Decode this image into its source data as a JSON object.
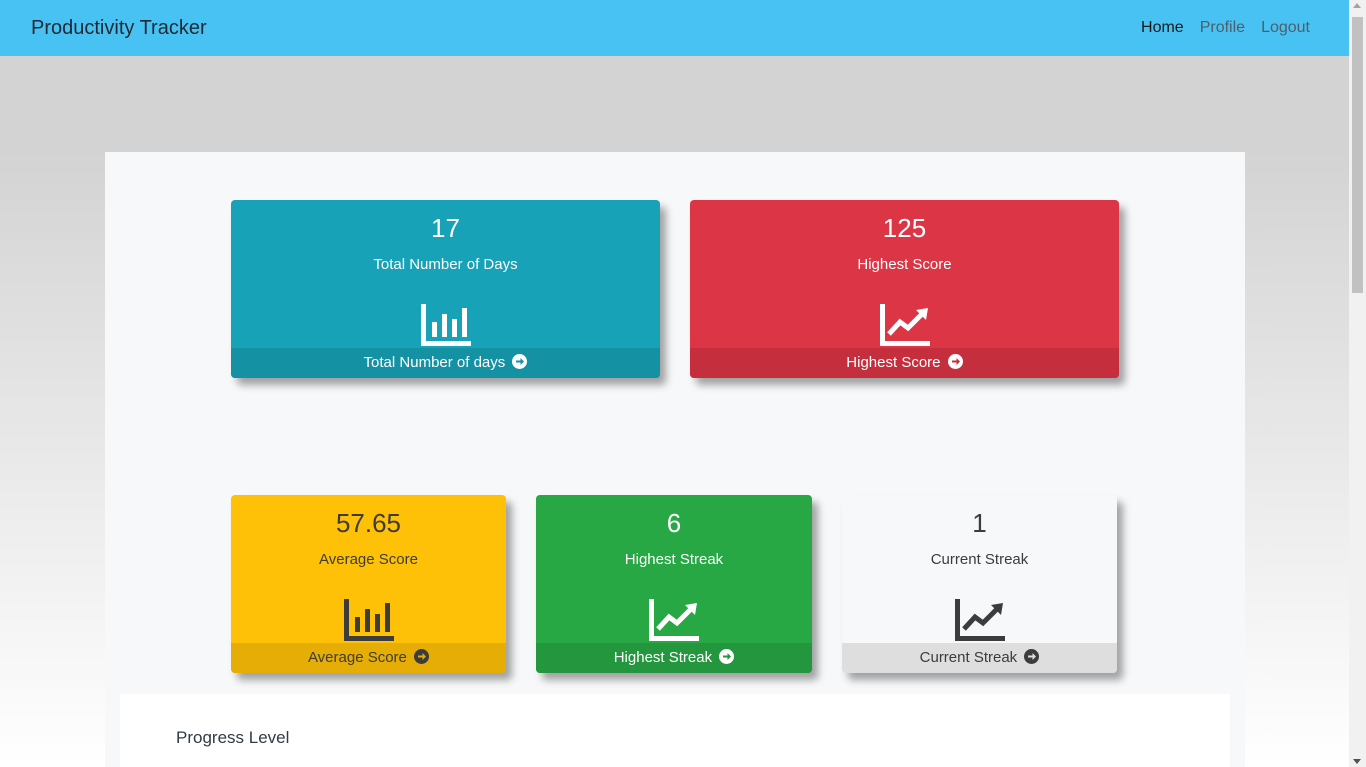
{
  "app": {
    "title": "Productivity Tracker"
  },
  "nav": {
    "items": [
      {
        "label": "Home",
        "active": true
      },
      {
        "label": "Profile",
        "active": false
      },
      {
        "label": "Logout",
        "active": false
      }
    ]
  },
  "cards": {
    "total_days": {
      "value": "17",
      "title": "Total Number of Days",
      "footer": "Total Number of days",
      "icon": "bar-chart-icon"
    },
    "highest_score": {
      "value": "125",
      "title": "Highest Score",
      "footer": "Highest Score",
      "icon": "line-chart-icon"
    },
    "average_score": {
      "value": "57.65",
      "title": "Average Score",
      "footer": "Average Score",
      "icon": "bar-chart-icon"
    },
    "highest_streak": {
      "value": "6",
      "title": "Highest Streak",
      "footer": "Highest Streak",
      "icon": "line-chart-icon"
    },
    "current_streak": {
      "value": "1",
      "title": "Current Streak",
      "footer": "Current Streak",
      "icon": "line-chart-icon"
    }
  },
  "progress": {
    "title": "Progress Level"
  },
  "colors": {
    "navbar": "#48c2f3",
    "teal": "#17a2b8",
    "red": "#dc3545",
    "yellow": "#ffc107",
    "green": "#28a745",
    "light": "#f7f8fa"
  }
}
